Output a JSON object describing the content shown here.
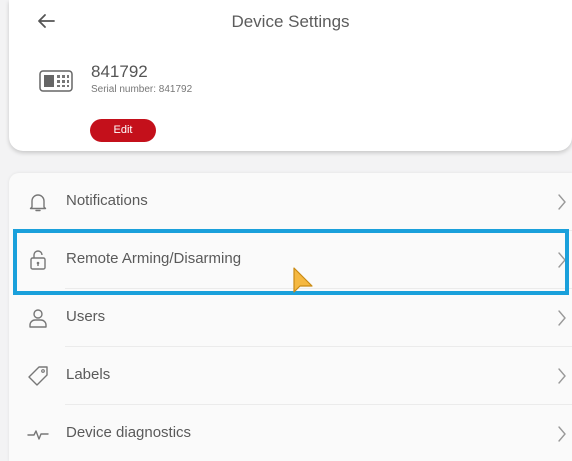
{
  "header": {
    "title": "Device Settings"
  },
  "device": {
    "name": "841792",
    "serial": "Serial number: 841792",
    "edit_label": "Edit"
  },
  "menu": {
    "items": [
      {
        "label": "Notifications",
        "icon": "bell-icon"
      },
      {
        "label": "Remote Arming/Disarming",
        "icon": "lock-icon"
      },
      {
        "label": "Users",
        "icon": "user-icon"
      },
      {
        "label": "Labels",
        "icon": "tag-icon"
      },
      {
        "label": "Device diagnostics",
        "icon": "pulse-icon"
      }
    ]
  },
  "colors": {
    "accent": "#c4101b",
    "highlight": "#1aa0db",
    "cursor": "#f5b841"
  }
}
